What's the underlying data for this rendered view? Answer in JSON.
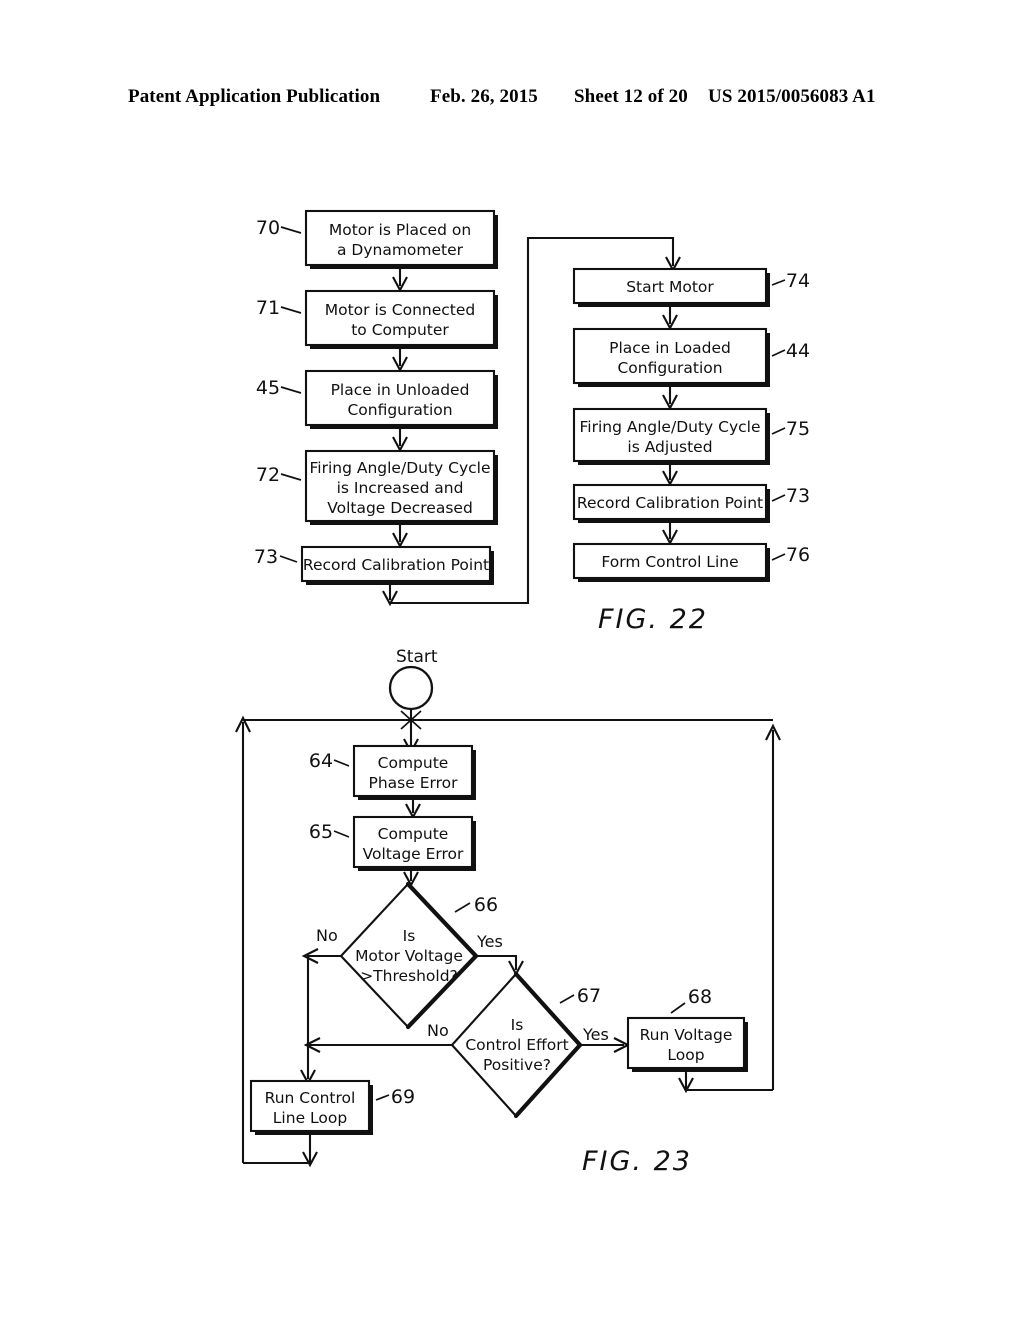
{
  "header": {
    "publication": "Patent Application Publication",
    "date": "Feb. 26, 2015",
    "sheet": "Sheet 12 of 20",
    "pubnumber": "US 2015/0056083 A1"
  },
  "fig22": {
    "label": "FIG. 22",
    "left_column": [
      {
        "ref": "70",
        "text_lines": [
          "Motor is Placed on",
          "a Dynamometer"
        ]
      },
      {
        "ref": "71",
        "text_lines": [
          "Motor is Connected",
          "to Computer"
        ]
      },
      {
        "ref": "45",
        "text_lines": [
          "Place in Unloaded",
          "Configuration"
        ]
      },
      {
        "ref": "72",
        "text_lines": [
          "Firing Angle/Duty Cycle",
          "is Increased and",
          "Voltage Decreased"
        ]
      },
      {
        "ref": "73",
        "text_lines": [
          "Record Calibration Point"
        ]
      }
    ],
    "right_column": [
      {
        "ref": "74",
        "text_lines": [
          "Start Motor"
        ]
      },
      {
        "ref": "44",
        "text_lines": [
          "Place in Loaded",
          "Configuration"
        ]
      },
      {
        "ref": "75",
        "text_lines": [
          "Firing Angle/Duty Cycle",
          "is Adjusted"
        ]
      },
      {
        "ref": "73",
        "text_lines": [
          "Record Calibration Point"
        ]
      },
      {
        "ref": "76",
        "text_lines": [
          "Form Control Line"
        ]
      }
    ]
  },
  "fig23": {
    "label": "FIG. 23",
    "start_label": "Start",
    "process_boxes": [
      {
        "ref": "64",
        "text_lines": [
          "Compute",
          "Phase Error"
        ]
      },
      {
        "ref": "65",
        "text_lines": [
          "Compute",
          "Voltage Error"
        ]
      },
      {
        "ref": "68",
        "text_lines": [
          "Run Voltage",
          "Loop"
        ]
      },
      {
        "ref": "69",
        "text_lines": [
          "Run Control",
          "Line Loop"
        ]
      }
    ],
    "decisions": [
      {
        "ref": "66",
        "text_lines": [
          "Is",
          "Motor Voltage",
          ">Threshold?"
        ],
        "no_label": "No",
        "yes_label": "Yes"
      },
      {
        "ref": "67",
        "text_lines": [
          "Is",
          "Control Effort",
          "Positive?"
        ],
        "no_label": "No",
        "yes_label": "Yes"
      }
    ]
  },
  "colors": {
    "ink": "#111111",
    "paper": "#ffffff"
  }
}
